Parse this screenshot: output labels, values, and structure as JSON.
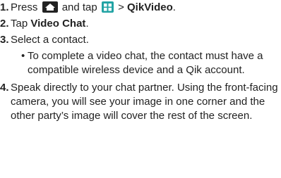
{
  "step1": {
    "num": "1.",
    "t1": "Press",
    "home_icon": "home-key-icon",
    "t2": "and tap",
    "apps_icon": "applications-icon",
    "t3": "> ",
    "target": "QikVideo",
    "t4": "."
  },
  "step2": {
    "num": "2.",
    "t1": "Tap ",
    "target": "Video Chat",
    "t2": "."
  },
  "step3": {
    "num": "3.",
    "text": "Select a contact."
  },
  "bullet": {
    "marker": "•",
    "text": "To complete a video chat, the contact must have a compatible wireless device and a Qik account."
  },
  "step4": {
    "num": "4.",
    "text": "Speak directly to your chat partner. Using the front-facing camera, you will see your image in one corner and the other party’s image will cover the rest of the screen."
  },
  "colors": {
    "text": "#222222",
    "home_icon": "#222222",
    "apps_icon": "#22a3a4"
  }
}
